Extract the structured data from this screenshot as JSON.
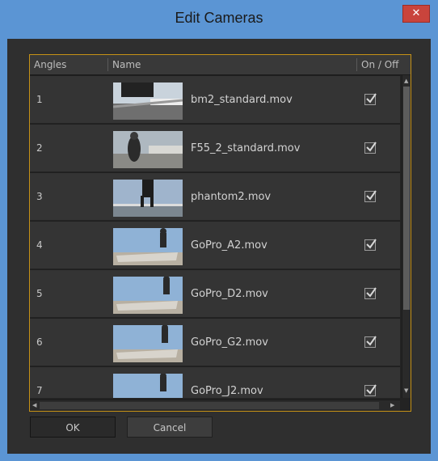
{
  "window": {
    "title": "Edit Cameras",
    "close_glyph": "✕"
  },
  "table": {
    "columns": [
      "Angles",
      "Name",
      "On / Off"
    ],
    "rows": [
      {
        "angle": "1",
        "name": "bm2_standard.mov",
        "on": true
      },
      {
        "angle": "2",
        "name": "F55_2_standard.mov",
        "on": true
      },
      {
        "angle": "3",
        "name": "phantom2.mov",
        "on": true
      },
      {
        "angle": "4",
        "name": "GoPro_A2.mov",
        "on": true
      },
      {
        "angle": "5",
        "name": "GoPro_D2.mov",
        "on": true
      },
      {
        "angle": "6",
        "name": "GoPro_G2.mov",
        "on": true
      },
      {
        "angle": "7",
        "name": "GoPro_J2.mov",
        "on": true
      }
    ]
  },
  "buttons": {
    "ok": "OK",
    "cancel": "Cancel"
  },
  "colors": {
    "accent": "#c69216",
    "titlebar": "#5b95d4",
    "close": "#c9443c"
  }
}
